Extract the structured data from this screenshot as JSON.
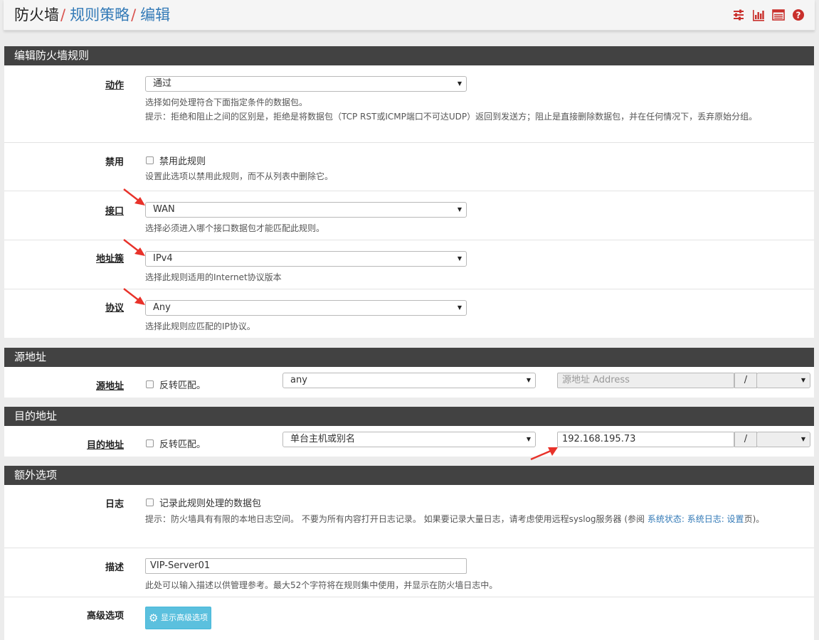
{
  "breadcrumb": {
    "first": "防火墙",
    "second": "规则策略",
    "third": "编辑",
    "sep": "/"
  },
  "top_icons": [
    "sliders-icon",
    "bar-chart-icon",
    "table-icon",
    "help-icon"
  ],
  "colors": {
    "panel_header": "#424242",
    "link": "#337ab7",
    "separator": "#d9534f",
    "button": "#5bc0de",
    "arrow": "#e8322a"
  },
  "edit_panel": {
    "title": "编辑防火墙规则",
    "action": {
      "label": "动作",
      "value": "通过",
      "help1": "选择如何处理符合下面指定条件的数据包。",
      "help2": "提示：拒绝和阻止之间的区别是，拒绝是将数据包（TCP RST或ICMP端口不可达UDP）返回到发送方；阻止是直接删除数据包，并在任何情况下，丢弃原始分组。"
    },
    "disabled": {
      "label": "禁用",
      "checkbox_label": "禁用此规则",
      "help": "设置此选项以禁用此规则，而不从列表中删除它。"
    },
    "interface": {
      "label": "接口",
      "value": "WAN",
      "help": "选择必须进入哪个接口数据包才能匹配此规则。"
    },
    "family": {
      "label": "地址簇",
      "value": "IPv4",
      "help": "选择此规则适用的Internet协议版本"
    },
    "protocol": {
      "label": "协议",
      "value": "Any",
      "help": "选择此规则应匹配的IP协议。"
    }
  },
  "source_panel": {
    "title": "源地址",
    "label": "源地址",
    "invert_label": "反转匹配。",
    "type_value": "any",
    "address_placeholder": "源地址 Address",
    "slash": "/"
  },
  "dest_panel": {
    "title": "目的地址",
    "label": "目的地址",
    "invert_label": "反转匹配。",
    "type_value": "单台主机或别名",
    "address_value": "192.168.195.73",
    "slash": "/"
  },
  "extra_panel": {
    "title": "额外选项",
    "log": {
      "label": "日志",
      "checkbox_label": "记录此规则处理的数据包",
      "help_prefix": "提示：防火墙具有有限的本地日志空间。 不要为所有内容打开日志记录。 如果要记录大量日志，请考虑使用远程syslog服务器 (参阅 ",
      "help_link": "系统状态: 系统日志: 设置",
      "help_suffix": "页)。"
    },
    "description": {
      "label": "描述",
      "value": "VIP-Server01",
      "help": "此处可以输入描述以供管理参考。最大52个字符将在规则集中使用，并显示在防火墙日志中。"
    },
    "advanced": {
      "label": "高级选项",
      "button_label": "显示高级选项"
    }
  }
}
